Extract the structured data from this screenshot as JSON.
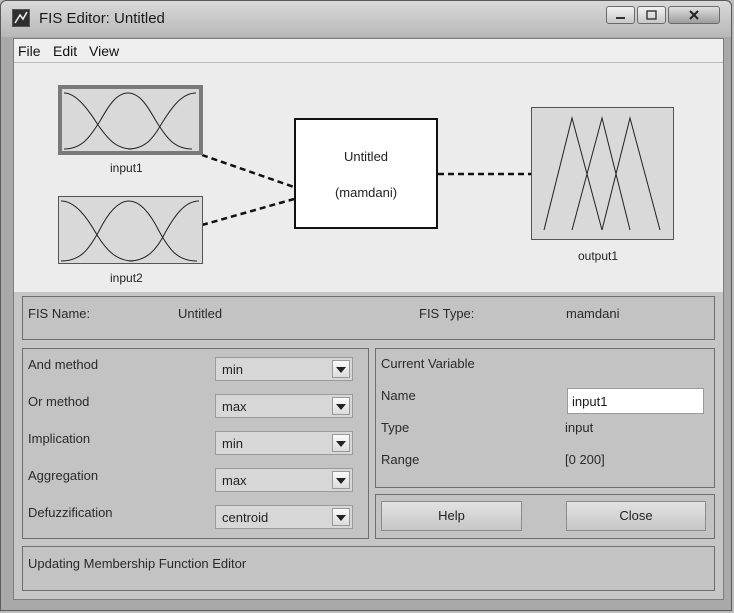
{
  "window": {
    "title": "FIS Editor: Untitled"
  },
  "menu": {
    "items": [
      "File",
      "Edit",
      "View"
    ]
  },
  "diagram": {
    "inputs": [
      {
        "label": "input1",
        "selected": true
      },
      {
        "label": "input2",
        "selected": false
      }
    ],
    "system": {
      "name": "Untitled",
      "type": "(mamdani)"
    },
    "output": {
      "label": "output1"
    }
  },
  "fis_info": {
    "name_label": "FIS Name:",
    "name_value": "Untitled",
    "type_label": "FIS Type:",
    "type_value": "mamdani"
  },
  "methods": [
    {
      "label": "And method",
      "value": "min"
    },
    {
      "label": "Or method",
      "value": "max"
    },
    {
      "label": "Implication",
      "value": "min"
    },
    {
      "label": "Aggregation",
      "value": "max"
    },
    {
      "label": "Defuzzification",
      "value": "centroid"
    }
  ],
  "current_variable": {
    "heading": "Current Variable",
    "name_label": "Name",
    "name_value": "input1",
    "type_label": "Type",
    "type_value": "input",
    "range_label": "Range",
    "range_value": "[0 200]"
  },
  "buttons": {
    "help": "Help",
    "close": "Close"
  },
  "status": {
    "text": "Updating Membership Function Editor"
  }
}
